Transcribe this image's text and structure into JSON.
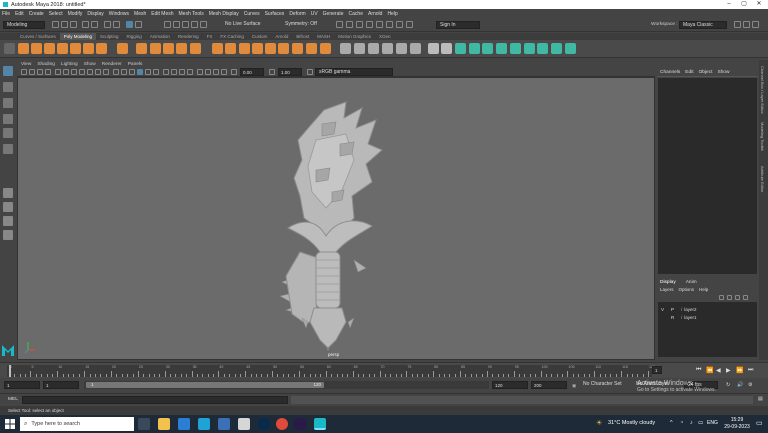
{
  "window": {
    "title": "Autodesk Maya 2018: untitled*",
    "minimize": "–",
    "maximize": "▢",
    "close": "✕"
  },
  "menu": [
    "File",
    "Edit",
    "Create",
    "Select",
    "Modify",
    "Display",
    "Windows",
    "Mesh",
    "Edit Mesh",
    "Mesh Tools",
    "Mesh Display",
    "Curves",
    "Surfaces",
    "Deform",
    "UV",
    "Generate",
    "Cache",
    "Arnold",
    "Help"
  ],
  "status": {
    "mode": "Modeling",
    "live": "No Live Surface",
    "symmetry": "Symmetry: Off",
    "signin": "Sign In",
    "workspace_label": "Workspace :",
    "workspace": "Maya Classic"
  },
  "shelf_tabs": [
    "Curves / Surfaces",
    "Poly Modeling",
    "Sculpting",
    "Rigging",
    "Animation",
    "Rendering",
    "FX",
    "FX Caching",
    "Custom",
    "Arnold",
    "Bifrost",
    "MASH",
    "Motion Graphics",
    "XGen"
  ],
  "shelf_active": "Poly Modeling",
  "panel_menu": [
    "View",
    "Shading",
    "Lighting",
    "Show",
    "Renderer",
    "Panels"
  ],
  "panel_tools": {
    "exposure": "0.00",
    "gamma": "1.00",
    "colorspace": "sRGB gamma"
  },
  "viewport": {
    "camera": "persp"
  },
  "channel_box": {
    "menu": [
      "Channels",
      "Edit",
      "Object",
      "Show"
    ]
  },
  "layer_editor": {
    "tabs": [
      "Display",
      "Anim"
    ],
    "menu": [
      "Layers",
      "Options",
      "Help"
    ],
    "layers": [
      {
        "v": "V",
        "p": "P",
        "name": "layer2"
      },
      {
        "v": "",
        "p": "R",
        "name": "layer1"
      }
    ]
  },
  "side_tabs": [
    "Channel Box / Layer Editor",
    "Modeling Toolkit",
    "Attribute Editor"
  ],
  "timeline": {
    "labels": [
      "1",
      "5",
      "10",
      "15",
      "20",
      "25",
      "30",
      "35",
      "40",
      "45",
      "50",
      "55",
      "60",
      "65",
      "70",
      "75",
      "80",
      "85",
      "90",
      "95",
      "100",
      "105",
      "110",
      "115",
      "120"
    ],
    "current": "1"
  },
  "range": {
    "start": "1",
    "start2": "1",
    "slider_start": "1",
    "slider_end": "120",
    "end": "120",
    "end2": "200",
    "char_set": "No Character Set",
    "anim_layer": "No Anim Layer",
    "fps": "24 fps"
  },
  "cmd": {
    "label": "MEL"
  },
  "help": "Select Tool: select an object",
  "activate": {
    "line1": "Activate Windows",
    "line2": "Go to Settings to activate Windows."
  },
  "taskbar": {
    "search": "Type here to search",
    "weather": "31°C  Mostly cloudy",
    "lang": "ENG",
    "time": "15:29",
    "date": "29-09-2023"
  },
  "colors": {
    "viewport": "#6b6b6b",
    "accent": "#5285a6",
    "maya_logo": "#19b9c6"
  }
}
